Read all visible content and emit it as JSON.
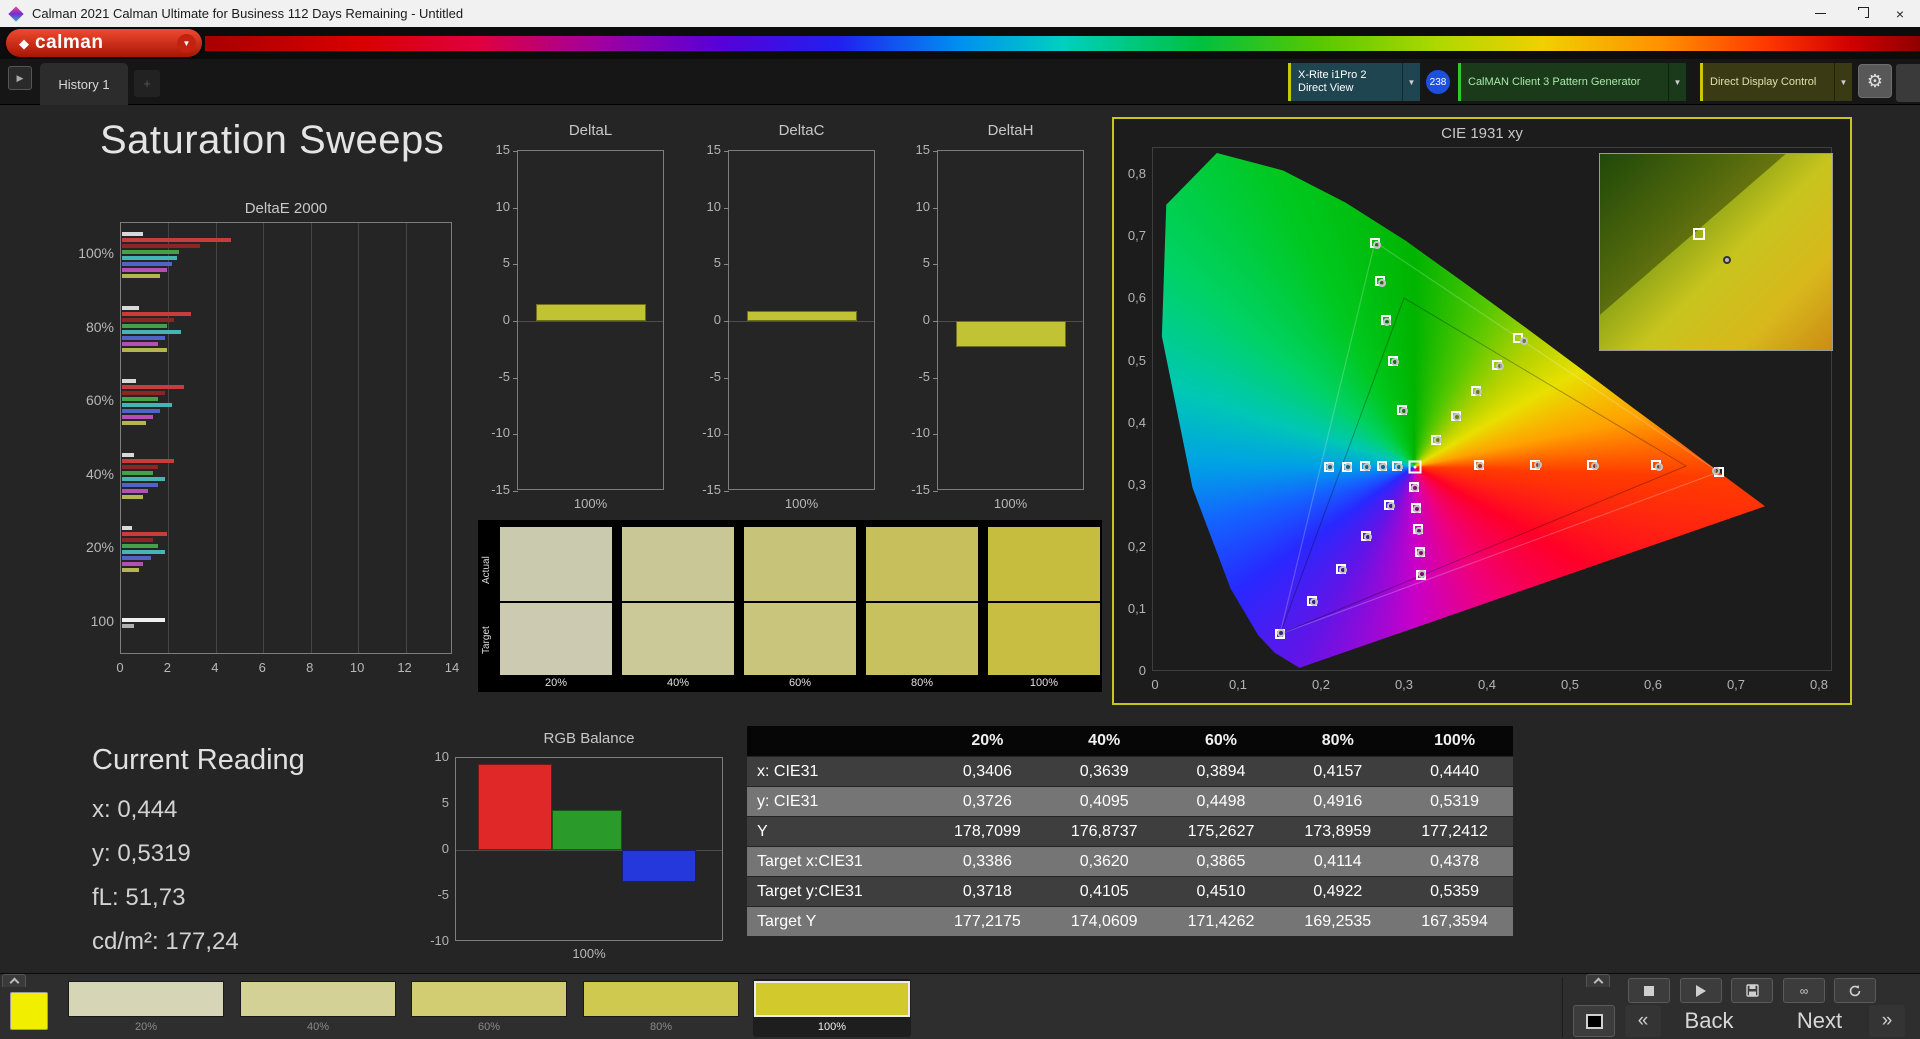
{
  "title_bar": {
    "title": "Calman 2021 Calman Ultimate for Business 112 Days Remaining  - Untitled"
  },
  "logo": {
    "text": "calman"
  },
  "tab_bar": {
    "history_tab": "History 1"
  },
  "toolbar": {
    "meter_line1": "X-Rite i1Pro 2",
    "meter_line2": "Direct View",
    "badge": "238",
    "pattern_source": "CalMAN Client 3 Pattern Generator",
    "display_control": "Direct Display Control"
  },
  "page": {
    "title": "Saturation Sweeps"
  },
  "icons": {
    "logo_mark": "◆",
    "dropdown_arrow": "▼",
    "expand_arrow": "▶",
    "gear": "⚙",
    "close": "×",
    "back_chevron": "«",
    "next_chevron": "»",
    "infinity": "∞",
    "plus": "+"
  },
  "chart_data": {
    "deltae": {
      "type": "bar",
      "title": "DeltaE 2000",
      "x_ticks": [
        "0",
        "2",
        "4",
        "6",
        "8",
        "10",
        "12",
        "14"
      ],
      "x_max": 14,
      "groups": [
        {
          "label": "100%",
          "bars": [
            {
              "color": "#d9d9d9",
              "value": 0.9
            },
            {
              "color": "#c83c3c",
              "value": 4.6
            },
            {
              "color": "#8c2626",
              "value": 3.3
            },
            {
              "color": "#46a046",
              "value": 2.4
            },
            {
              "color": "#46b4b4",
              "value": 2.3
            },
            {
              "color": "#5064c8",
              "value": 2.1
            },
            {
              "color": "#b450b4",
              "value": 1.9
            },
            {
              "color": "#b4b450",
              "value": 1.6
            }
          ]
        },
        {
          "label": "80%",
          "bars": [
            {
              "color": "#d9d9d9",
              "value": 0.7
            },
            {
              "color": "#c83c3c",
              "value": 2.9
            },
            {
              "color": "#8c2626",
              "value": 2.2
            },
            {
              "color": "#46a046",
              "value": 1.9
            },
            {
              "color": "#46b4b4",
              "value": 2.5
            },
            {
              "color": "#5064c8",
              "value": 1.8
            },
            {
              "color": "#b450b4",
              "value": 1.5
            },
            {
              "color": "#b4b450",
              "value": 1.9
            }
          ]
        },
        {
          "label": "60%",
          "bars": [
            {
              "color": "#d9d9d9",
              "value": 0.6
            },
            {
              "color": "#c83c3c",
              "value": 2.6
            },
            {
              "color": "#8c2626",
              "value": 1.8
            },
            {
              "color": "#46a046",
              "value": 1.5
            },
            {
              "color": "#46b4b4",
              "value": 2.1
            },
            {
              "color": "#5064c8",
              "value": 1.6
            },
            {
              "color": "#b450b4",
              "value": 1.3
            },
            {
              "color": "#b4b450",
              "value": 1.0
            }
          ]
        },
        {
          "label": "40%",
          "bars": [
            {
              "color": "#d9d9d9",
              "value": 0.5
            },
            {
              "color": "#c83c3c",
              "value": 2.2
            },
            {
              "color": "#8c2626",
              "value": 1.5
            },
            {
              "color": "#46a046",
              "value": 1.3
            },
            {
              "color": "#46b4b4",
              "value": 1.8
            },
            {
              "color": "#5064c8",
              "value": 1.5
            },
            {
              "color": "#b450b4",
              "value": 1.1
            },
            {
              "color": "#b4b450",
              "value": 0.9
            }
          ]
        },
        {
          "label": "20%",
          "bars": [
            {
              "color": "#d9d9d9",
              "value": 0.4
            },
            {
              "color": "#c83c3c",
              "value": 1.9
            },
            {
              "color": "#8c2626",
              "value": 1.3
            },
            {
              "color": "#46a046",
              "value": 1.5
            },
            {
              "color": "#46b4b4",
              "value": 1.8
            },
            {
              "color": "#5064c8",
              "value": 1.2
            },
            {
              "color": "#b450b4",
              "value": 0.9
            },
            {
              "color": "#b4b450",
              "value": 0.7
            }
          ]
        },
        {
          "label": "100",
          "bars": [
            {
              "color": "#f0f0f0",
              "value": 1.8
            },
            {
              "color": "#b0b0b0",
              "value": 0.5
            }
          ]
        }
      ]
    },
    "delta_minis": {
      "type": "bar",
      "y_ticks": [
        "15",
        "10",
        "5",
        "0",
        "-5",
        "-10",
        "-15"
      ],
      "y_max": 15,
      "xlabel": "100%",
      "bar_color": "#c2c235",
      "charts": [
        {
          "title": "DeltaL",
          "value": 1.5
        },
        {
          "title": "DeltaC",
          "value": 0.9
        },
        {
          "title": "DeltaH",
          "value": -2.3
        }
      ]
    },
    "cie": {
      "type": "scatter",
      "title": "CIE 1931 xy",
      "x_ticks": [
        "0",
        "0,1",
        "0,2",
        "0,3",
        "0,4",
        "0,5",
        "0,6",
        "0,7",
        "0,8"
      ],
      "y_ticks": [
        "0,8",
        "0,7",
        "0,6",
        "0,5",
        "0,4",
        "0,3",
        "0,2",
        "0,1",
        "0"
      ],
      "white_point": [
        0.3127,
        0.329
      ],
      "targets": [
        [
          0.39,
          0.331
        ],
        [
          0.458,
          0.332
        ],
        [
          0.527,
          0.332
        ],
        [
          0.603,
          0.331
        ],
        [
          0.68,
          0.321
        ],
        [
          0.298,
          0.42
        ],
        [
          0.287,
          0.5
        ],
        [
          0.278,
          0.565
        ],
        [
          0.271,
          0.628
        ],
        [
          0.265,
          0.69
        ],
        [
          0.282,
          0.268
        ],
        [
          0.254,
          0.218
        ],
        [
          0.224,
          0.165
        ],
        [
          0.189,
          0.113
        ],
        [
          0.15,
          0.06
        ],
        [
          0.292,
          0.33
        ],
        [
          0.273,
          0.33
        ],
        [
          0.253,
          0.33
        ],
        [
          0.231,
          0.329
        ],
        [
          0.209,
          0.329
        ],
        [
          0.312,
          0.296
        ],
        [
          0.314,
          0.263
        ],
        [
          0.317,
          0.228
        ],
        [
          0.319,
          0.192
        ],
        [
          0.321,
          0.155
        ],
        [
          0.3386,
          0.3718
        ],
        [
          0.362,
          0.4105
        ],
        [
          0.3865,
          0.451
        ],
        [
          0.4114,
          0.4922
        ],
        [
          0.4378,
          0.5359
        ]
      ],
      "measured": [
        [
          0.392,
          0.33
        ],
        [
          0.461,
          0.331
        ],
        [
          0.53,
          0.33
        ],
        [
          0.607,
          0.329
        ],
        [
          0.676,
          0.322
        ],
        [
          0.3,
          0.418
        ],
        [
          0.289,
          0.497
        ],
        [
          0.28,
          0.562
        ],
        [
          0.273,
          0.625
        ],
        [
          0.267,
          0.686
        ],
        [
          0.284,
          0.266
        ],
        [
          0.256,
          0.216
        ],
        [
          0.226,
          0.163
        ],
        [
          0.191,
          0.111
        ],
        [
          0.152,
          0.062
        ],
        [
          0.294,
          0.329
        ],
        [
          0.275,
          0.329
        ],
        [
          0.255,
          0.329
        ],
        [
          0.233,
          0.328
        ],
        [
          0.211,
          0.328
        ],
        [
          0.313,
          0.294
        ],
        [
          0.315,
          0.261
        ],
        [
          0.318,
          0.226
        ],
        [
          0.32,
          0.19
        ],
        [
          0.322,
          0.157
        ],
        [
          0.3406,
          0.3726
        ],
        [
          0.3639,
          0.4095
        ],
        [
          0.3894,
          0.4498
        ],
        [
          0.4157,
          0.4916
        ],
        [
          0.444,
          0.5319
        ]
      ]
    },
    "rgb_balance": {
      "type": "bar",
      "title": "RGB Balance",
      "xlabel": "100%",
      "y_ticks": [
        "10",
        "5",
        "0",
        "-5",
        "-10"
      ],
      "y_max": 10,
      "bars": [
        {
          "name": "red",
          "color": "#e02828",
          "value": 9.3
        },
        {
          "name": "green",
          "color": "#2a9a2a",
          "value": 4.4
        },
        {
          "name": "blue",
          "color": "#2438dc",
          "value": -3.5
        }
      ]
    }
  },
  "swatch_panel": {
    "row_labels": [
      "Actual",
      "Target"
    ],
    "columns": [
      {
        "label": "20%",
        "actual": "#cacaae",
        "target": "#cccbb1"
      },
      {
        "label": "40%",
        "actual": "#c9c795",
        "target": "#cbc998"
      },
      {
        "label": "60%",
        "actual": "#c7c379",
        "target": "#c9c57c"
      },
      {
        "label": "80%",
        "actual": "#c6bf5c",
        "target": "#c8c160"
      },
      {
        "label": "100%",
        "actual": "#c6bd3e",
        "target": "#c8bf42"
      }
    ]
  },
  "current_reading": {
    "title": "Current Reading",
    "lines": [
      "x: 0,444",
      "y: 0,5319",
      "fL: 51,73",
      "cd/m²: 177,24"
    ]
  },
  "data_table": {
    "columns": [
      "",
      "20%",
      "40%",
      "60%",
      "80%",
      "100%"
    ],
    "rows": [
      {
        "label": "x: CIE31",
        "values": [
          "0,3406",
          "0,3639",
          "0,3894",
          "0,4157",
          "0,4440"
        ]
      },
      {
        "label": "y: CIE31",
        "values": [
          "0,3726",
          "0,4095",
          "0,4498",
          "0,4916",
          "0,5319"
        ]
      },
      {
        "label": "Y",
        "values": [
          "178,7099",
          "176,8737",
          "175,2627",
          "173,8959",
          "177,2412"
        ]
      },
      {
        "label": "Target x:CIE31",
        "values": [
          "0,3386",
          "0,3620",
          "0,3865",
          "0,4114",
          "0,4378"
        ]
      },
      {
        "label": "Target y:CIE31",
        "values": [
          "0,3718",
          "0,4105",
          "0,4510",
          "0,4922",
          "0,5359"
        ]
      },
      {
        "label": "Target Y",
        "values": [
          "177,2175",
          "174,0609",
          "171,4262",
          "169,2535",
          "167,3594"
        ]
      }
    ]
  },
  "bottom_bar": {
    "current_color": "#f2ee00",
    "patterns": [
      {
        "label": "20%",
        "color": "#d6d6b6",
        "selected": false
      },
      {
        "label": "40%",
        "color": "#d4d196",
        "selected": false
      },
      {
        "label": "60%",
        "color": "#d2cd73",
        "selected": false
      },
      {
        "label": "80%",
        "color": "#d0c950",
        "selected": false
      },
      {
        "label": "100%",
        "color": "#d2ca2c",
        "selected": true
      }
    ],
    "back_label": "Back",
    "next_label": "Next"
  }
}
